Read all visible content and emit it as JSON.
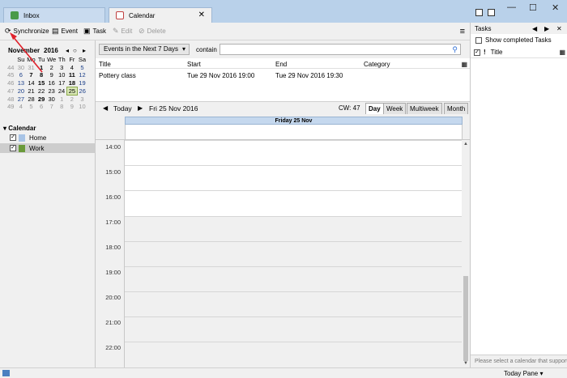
{
  "tabs": [
    {
      "label": "Inbox",
      "icon": "mail-icon"
    },
    {
      "label": "Calendar",
      "icon": "calendar-icon"
    }
  ],
  "toolbar": {
    "synchronize": "Synchronize",
    "event": "Event",
    "task": "Task",
    "edit": "Edit",
    "delete": "Delete"
  },
  "minical": {
    "month": "November",
    "year": "2016",
    "weekdays": [
      "Su",
      "Mo",
      "Tu",
      "We",
      "Th",
      "Fr",
      "Sa"
    ],
    "rows": [
      {
        "wk": "44",
        "days": [
          "30",
          "31",
          "1",
          "2",
          "3",
          "4",
          "5"
        ]
      },
      {
        "wk": "45",
        "days": [
          "6",
          "7",
          "8",
          "9",
          "10",
          "11",
          "12"
        ]
      },
      {
        "wk": "46",
        "days": [
          "13",
          "14",
          "15",
          "16",
          "17",
          "18",
          "19"
        ]
      },
      {
        "wk": "47",
        "days": [
          "20",
          "21",
          "22",
          "23",
          "24",
          "25",
          "26"
        ]
      },
      {
        "wk": "48",
        "days": [
          "27",
          "28",
          "29",
          "30",
          "1",
          "2",
          "3"
        ]
      },
      {
        "wk": "49",
        "days": [
          "4",
          "5",
          "6",
          "7",
          "8",
          "9",
          "10"
        ]
      }
    ],
    "today": "25"
  },
  "calendars": {
    "label": "Calendar",
    "items": [
      {
        "name": "Home",
        "color": "#a8c4e6",
        "checked": "✓"
      },
      {
        "name": "Work",
        "color": "#6a9a3a",
        "checked": "✓"
      }
    ]
  },
  "filter": {
    "selected": "Events in the Next 7 Days",
    "contain_label": "contain",
    "search_value": ""
  },
  "events": {
    "columns": [
      "Title",
      "Start",
      "End",
      "Category"
    ],
    "rows": [
      {
        "title": "Pottery class",
        "start": "Tue 29 Nov 2016 19:00",
        "end": "Tue 29 Nov 2016 19:30",
        "category": ""
      }
    ]
  },
  "daynav": {
    "today": "Today",
    "date": "Fri 25 Nov 2016",
    "cw": "CW: 47",
    "views": [
      "Day",
      "Week",
      "Multiweek",
      "Month"
    ],
    "active_view": "Day"
  },
  "dayview": {
    "header": "Friday 25 Nov",
    "times": [
      "14:00",
      "15:00",
      "16:00",
      "17:00",
      "18:00",
      "19:00",
      "20:00",
      "21:00",
      "22:00"
    ]
  },
  "tasks": {
    "title": "Tasks",
    "show_completed": "Show completed Tasks",
    "column_title": "Title",
    "message": "Please select a calendar that supports tasks"
  },
  "status": {
    "today_pane": "Today Pane ▾"
  },
  "colors": {
    "titlebar": "#b9d1ea",
    "accent": "#2f6fd6",
    "today_highlight": "#d9e8b5",
    "annotation": "#e0202a"
  }
}
